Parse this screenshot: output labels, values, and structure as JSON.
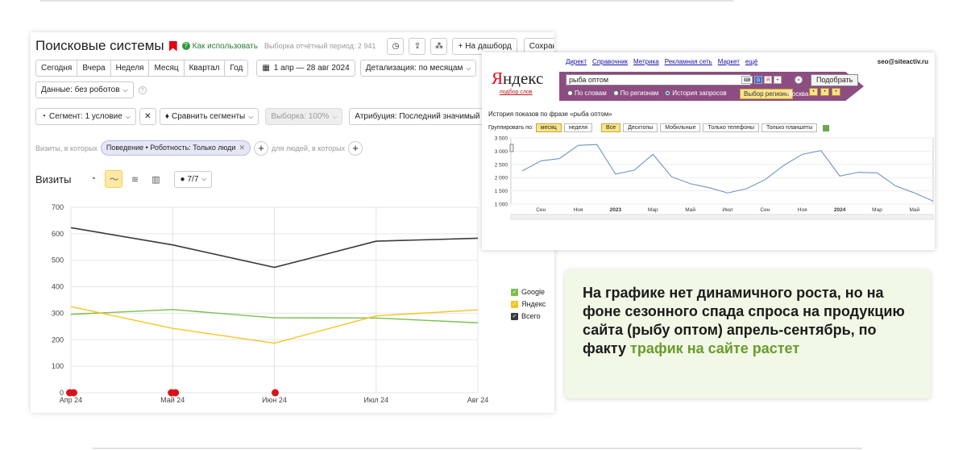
{
  "metrica": {
    "title": "Поисковые системы",
    "use_link": "Как использовать",
    "report_period": "Выборка отчётный период: 2 941",
    "dashboard_label": "На дашборд",
    "save_label": "Сохранить как",
    "period_buttons": [
      "Сегодня",
      "Вчера",
      "Неделя",
      "Месяц",
      "Квартал",
      "Год"
    ],
    "date_range": "1 апр — 28 авг 2024",
    "detail": "Детализация: по месяцам",
    "data_filter": "Данные: без роботов",
    "segment": "Сегмент: 1 условие",
    "compare": "Сравнить сегменты",
    "sample": "Выборка: 100%",
    "attribution": "Атрибуция: Последний значимый переход",
    "visits_filter_label": "Визиты, в которых",
    "filter_chip": "Поведение • Роботность: Только люди",
    "people_filter_label": "для людей, в которых",
    "visits_title": "Визиты",
    "series_counter": "7/7",
    "colors": {
      "google": "#7cbf4e",
      "yandex": "#f6c51f",
      "total": "#3a3a3a"
    }
  },
  "wordstat": {
    "links": [
      "Директ",
      "Справочник",
      "Метрика",
      "Рекламная сеть",
      "Маркет",
      "ещё"
    ],
    "user": "seo@siteactiv.ru",
    "logo_y": "Я",
    "logo_rest": "ндекс",
    "sublogo": "подбор слов",
    "query": "рыба оптом",
    "submit": "Подобрать",
    "radio_words": "По словам",
    "radio_regions": "По регионам",
    "radio_history": "История запросов",
    "region_button": "Выбор региона",
    "region": "Москва",
    "history_title": "История показов по фразе «рыба оптом»",
    "group_by": "Группировать по:",
    "group_tabs": [
      "месяц",
      "неделя"
    ],
    "device_tabs": [
      "Все",
      "Десктопы",
      "Мобильные",
      "Только телефоны",
      "Только планшеты"
    ]
  },
  "callout": {
    "text": "На графике нет динамичного роста, но на фоне сезонного спада спроса на продукцию сайта (рыбу оптом) апрель-сентябрь, по факту ",
    "highlight": "трафик на сайте растет"
  },
  "chart_data": [
    {
      "type": "line",
      "categories": [
        "Апр 24",
        "Май 24",
        "Июн 24",
        "Июл 24",
        "Авг 24"
      ],
      "series": [
        {
          "name": "Google",
          "values": [
            296,
            314,
            283,
            282,
            264
          ]
        },
        {
          "name": "Яндекс",
          "values": [
            325,
            243,
            187,
            290,
            313
          ]
        },
        {
          "name": "Всего",
          "values": [
            623,
            558,
            473,
            572,
            583
          ]
        }
      ],
      "yticks": [
        0,
        100,
        200,
        300,
        400,
        500,
        600,
        700
      ],
      "ylim": [
        0,
        700
      ],
      "grid": true,
      "legend": "right"
    },
    {
      "type": "line",
      "x_labels": [
        "Сен",
        "Ноя",
        "2023",
        "Мар",
        "Май",
        "Июл",
        "Сен",
        "Ноя",
        "2024",
        "Мар",
        "Май"
      ],
      "series": [
        {
          "values": [
            2250,
            2630,
            2720,
            3220,
            3250,
            2130,
            2280,
            2880,
            2030,
            1770,
            1620,
            1420,
            1580,
            1920,
            2460,
            2880,
            3020,
            2060,
            2200,
            2180,
            1680,
            1420,
            1110
          ]
        }
      ],
      "yticks": [
        1000,
        1500,
        2000,
        2500,
        3000,
        3500
      ],
      "ylim": [
        1000,
        3500
      ],
      "grid": true
    }
  ]
}
